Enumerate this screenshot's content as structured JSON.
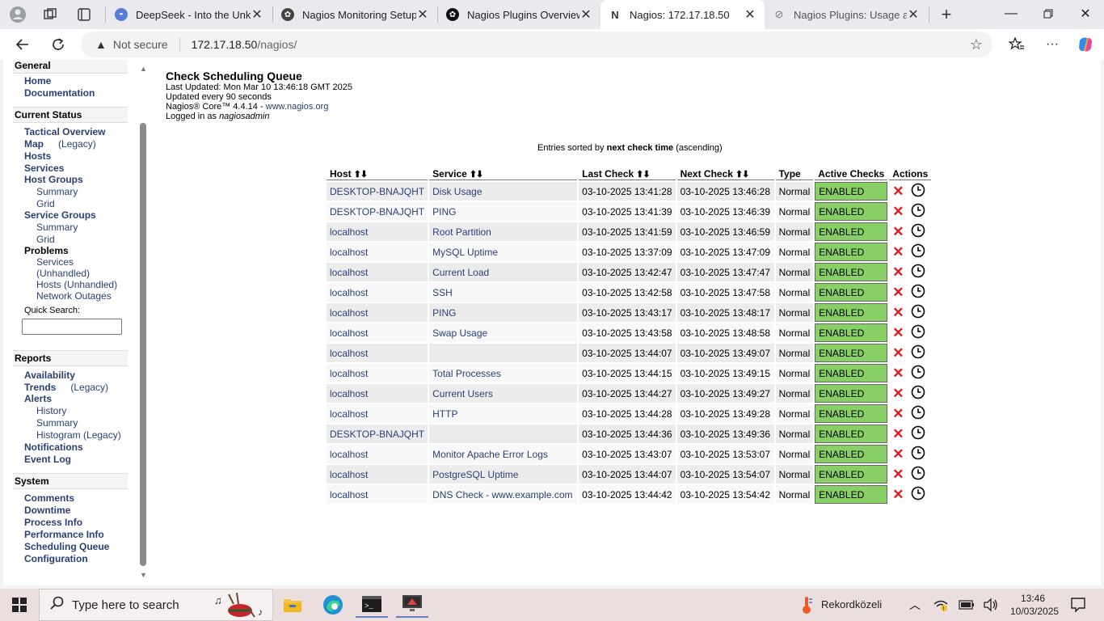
{
  "browser": {
    "tabs": [
      {
        "title": "DeepSeek - Into the Unknow",
        "active": false
      },
      {
        "title": "Nagios Monitoring Setup",
        "active": false
      },
      {
        "title": "Nagios Plugins Overview",
        "active": false
      },
      {
        "title": "Nagios: 172.17.18.50",
        "active": true
      },
      {
        "title": "Nagios Plugins: Usage and",
        "active": false
      }
    ],
    "address": {
      "security": "Not secure",
      "host": "172.17.18.50",
      "path": "/nagios/"
    }
  },
  "sidebar": {
    "general": {
      "header": "General",
      "home": "Home",
      "documentation": "Documentation"
    },
    "current_status": {
      "header": "Current Status",
      "tactical_overview": "Tactical Overview",
      "map": "Map",
      "map_legacy": "(Legacy)",
      "hosts": "Hosts",
      "services": "Services",
      "host_groups": "Host Groups",
      "hg_summary": "Summary",
      "hg_grid": "Grid",
      "service_groups": "Service Groups",
      "sg_summary": "Summary",
      "sg_grid": "Grid",
      "problems": "Problems",
      "p_services": "Services",
      "p_services_unhandled": "(Unhandled)",
      "p_hosts": "Hosts",
      "p_hosts_unhandled": "(Unhandled)",
      "p_network_outages": "Network Outages",
      "quick_search_label": "Quick Search:"
    },
    "reports": {
      "header": "Reports",
      "availability": "Availability",
      "trends": "Trends",
      "trends_legacy": "(Legacy)",
      "alerts": "Alerts",
      "history": "History",
      "summary": "Summary",
      "histogram": "Histogram",
      "histogram_legacy": "(Legacy)",
      "notifications": "Notifications",
      "event_log": "Event Log"
    },
    "system": {
      "header": "System",
      "comments": "Comments",
      "downtime": "Downtime",
      "process_info": "Process Info",
      "performance_info": "Performance Info",
      "scheduling_queue": "Scheduling Queue",
      "configuration": "Configuration"
    }
  },
  "page": {
    "title": "Check Scheduling Queue",
    "last_updated": "Last Updated: Mon Mar 10 13:46:18 GMT 2025",
    "updated_every": "Updated every 90 seconds",
    "core_version": "Nagios® Core™ 4.4.14 - ",
    "core_link": "www.nagios.org",
    "logged_in_prefix": "Logged in as ",
    "logged_in_user": "nagiosadmin",
    "sort_prefix": "Entries sorted by ",
    "sort_field": "next check time",
    "sort_suffix": " (ascending)"
  },
  "table": {
    "headers": {
      "host": "Host",
      "service": "Service",
      "last_check": "Last Check",
      "next_check": "Next Check",
      "type": "Type",
      "active_checks": "Active Checks",
      "actions": "Actions"
    },
    "rows": [
      {
        "host": "DESKTOP-BNAJQHT",
        "service": "Disk Usage",
        "last": "03-10-2025 13:41:28",
        "next": "03-10-2025 13:46:28",
        "type": "Normal",
        "status": "ENABLED"
      },
      {
        "host": "DESKTOP-BNAJQHT",
        "service": "PING",
        "last": "03-10-2025 13:41:39",
        "next": "03-10-2025 13:46:39",
        "type": "Normal",
        "status": "ENABLED"
      },
      {
        "host": "localhost",
        "service": "Root Partition",
        "last": "03-10-2025 13:41:59",
        "next": "03-10-2025 13:46:59",
        "type": "Normal",
        "status": "ENABLED"
      },
      {
        "host": "localhost",
        "service": "MySQL Uptime",
        "last": "03-10-2025 13:37:09",
        "next": "03-10-2025 13:47:09",
        "type": "Normal",
        "status": "ENABLED"
      },
      {
        "host": "localhost",
        "service": "Current Load",
        "last": "03-10-2025 13:42:47",
        "next": "03-10-2025 13:47:47",
        "type": "Normal",
        "status": "ENABLED"
      },
      {
        "host": "localhost",
        "service": "SSH",
        "last": "03-10-2025 13:42:58",
        "next": "03-10-2025 13:47:58",
        "type": "Normal",
        "status": "ENABLED"
      },
      {
        "host": "localhost",
        "service": "PING",
        "last": "03-10-2025 13:43:17",
        "next": "03-10-2025 13:48:17",
        "type": "Normal",
        "status": "ENABLED"
      },
      {
        "host": "localhost",
        "service": "Swap Usage",
        "last": "03-10-2025 13:43:58",
        "next": "03-10-2025 13:48:58",
        "type": "Normal",
        "status": "ENABLED"
      },
      {
        "host": "localhost",
        "service": "",
        "last": "03-10-2025 13:44:07",
        "next": "03-10-2025 13:49:07",
        "type": "Normal",
        "status": "ENABLED"
      },
      {
        "host": "localhost",
        "service": "Total Processes",
        "last": "03-10-2025 13:44:15",
        "next": "03-10-2025 13:49:15",
        "type": "Normal",
        "status": "ENABLED"
      },
      {
        "host": "localhost",
        "service": "Current Users",
        "last": "03-10-2025 13:44:27",
        "next": "03-10-2025 13:49:27",
        "type": "Normal",
        "status": "ENABLED"
      },
      {
        "host": "localhost",
        "service": "HTTP",
        "last": "03-10-2025 13:44:28",
        "next": "03-10-2025 13:49:28",
        "type": "Normal",
        "status": "ENABLED"
      },
      {
        "host": "DESKTOP-BNAJQHT",
        "service": "",
        "last": "03-10-2025 13:44:36",
        "next": "03-10-2025 13:49:36",
        "type": "Normal",
        "status": "ENABLED"
      },
      {
        "host": "localhost",
        "service": "Monitor Apache Error Logs",
        "last": "03-10-2025 13:43:07",
        "next": "03-10-2025 13:53:07",
        "type": "Normal",
        "status": "ENABLED"
      },
      {
        "host": "localhost",
        "service": "PostgreSQL Uptime",
        "last": "03-10-2025 13:44:07",
        "next": "03-10-2025 13:54:07",
        "type": "Normal",
        "status": "ENABLED"
      },
      {
        "host": "localhost",
        "service": "DNS Check - www.example.com",
        "last": "03-10-2025 13:44:42",
        "next": "03-10-2025 13:54:42",
        "type": "Normal",
        "status": "ENABLED"
      }
    ]
  },
  "taskbar": {
    "search_placeholder": "Type here to search",
    "weather": "Rekordközeli",
    "time": "13:46",
    "date": "10/03/2025"
  },
  "colors": {
    "link": "#2b3f76",
    "enabled_bg": "#88d066",
    "disable_icon": "#e0191e"
  }
}
